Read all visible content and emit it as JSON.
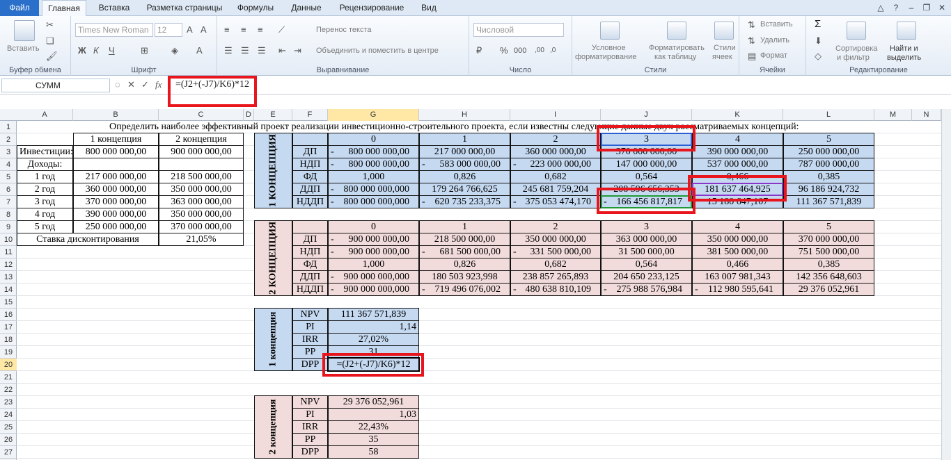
{
  "tabs": {
    "file": "Файл",
    "items": [
      "Главная",
      "Вставка",
      "Разметка страницы",
      "Формулы",
      "Данные",
      "Рецензирование",
      "Вид"
    ]
  },
  "ribbon": {
    "paste": "Вставить",
    "clipboard": "Буфер обмена",
    "font_name": "Times New Roman",
    "font_size": "12",
    "font_group": "Шрифт",
    "wrap": "Перенос текста",
    "merge": "Объединить и поместить в центре",
    "align_group": "Выравнивание",
    "number_format": "Числовой",
    "number_group": "Число",
    "cond_format": [
      "Условное",
      "форматирование"
    ],
    "format_table": [
      "Форматировать",
      "как таблицу"
    ],
    "styles": [
      "Стили",
      "ячеек"
    ],
    "styles_group": "Стили",
    "insert": "Вставить",
    "delete": "Удалить",
    "format": "Формат",
    "cells_group": "Ячейки",
    "sort": [
      "Сортировка",
      "и фильтр"
    ],
    "find": [
      "Найти и",
      "выделить"
    ],
    "edit_group": "Редактирование"
  },
  "formula_bar": {
    "name_box": "СУММ",
    "formula": "=(J2+(-J7)/K6)*12"
  },
  "columns": [
    "A",
    "B",
    "C",
    "D",
    "E",
    "F",
    "G",
    "H",
    "I",
    "J",
    "K",
    "L",
    "M",
    "N"
  ],
  "rows": [
    "1",
    "2",
    "3",
    "4",
    "5",
    "6",
    "7",
    "8",
    "9",
    "10",
    "11",
    "12",
    "13",
    "14",
    "15",
    "16",
    "17",
    "18",
    "19",
    "20",
    "21",
    "22",
    "23",
    "24",
    "25",
    "26",
    "27"
  ],
  "sheet": {
    "title": "Определить наиболее эффективный проект реализации инвестиционно-строительного проекта, если известны следующие данные двух рассматриваемых концепций:",
    "left": {
      "h1": "1 концепция",
      "h2": "2 концепция",
      "inv_label": "Инвестиции:",
      "inv1": "800 000 000,00",
      "inv2": "900 000 000,00",
      "inc_label": "Доходы:",
      "years": [
        [
          "1 год",
          "217 000 000,00",
          "218 500 000,00"
        ],
        [
          "2 год",
          "360 000 000,00",
          "350 000 000,00"
        ],
        [
          "3 год",
          "370 000 000,00",
          "363 000 000,00"
        ],
        [
          "4 год",
          "390 000 000,00",
          "350 000 000,00"
        ],
        [
          "5 год",
          "250 000 000,00",
          "370 000 000,00"
        ]
      ],
      "rate_label": "Ставка дисконтирования",
      "rate": "21,05%"
    },
    "periods": [
      "0",
      "1",
      "2",
      "3",
      "4",
      "5"
    ],
    "c1_label": "1 КОНЦЕПЦИЯ",
    "c2_label": "2 КОНЦЕПЦИЯ",
    "c1_rows": [
      [
        "ДП",
        "-",
        "800 000 000,00",
        "217 000 000,00",
        "360 000 000,00",
        "370 000 000,00",
        "390 000 000,00",
        "250 000 000,00"
      ],
      [
        "НДП",
        "-",
        "800 000 000,00",
        "-",
        "583 000 000,00",
        "-",
        "223 000 000,00",
        "147 000 000,00",
        "537 000 000,00",
        "787 000 000,00"
      ],
      [
        "ФД",
        "1,000",
        "0,826",
        "0,682",
        "0,564",
        "0,466",
        "0,385"
      ],
      [
        "ДДП",
        "-",
        "800 000 000,000",
        "179 264 766,625",
        "245 681 759,204",
        "208 596 656,353",
        "181 637 464,925",
        "96 186 924,732"
      ],
      [
        "НДДП",
        "-",
        "800 000 000,000",
        "-",
        "620 735 233,375",
        "-",
        "375 053 474,170",
        "-",
        "166 456 817,817",
        "15 180 647,107",
        "111 367 571,839"
      ]
    ],
    "c2_rows": [
      [
        "ДП",
        "-",
        "900 000 000,00",
        "218 500 000,00",
        "350 000 000,00",
        "363 000 000,00",
        "350 000 000,00",
        "370 000 000,00"
      ],
      [
        "НДП",
        "-",
        "900 000 000,00",
        "-",
        "681 500 000,00",
        "-",
        "331 500 000,00",
        "31 500 000,00",
        "381 500 000,00",
        "751 500 000,00"
      ],
      [
        "ФД",
        "1,000",
        "0,826",
        "0,682",
        "0,564",
        "0,466",
        "0,385"
      ],
      [
        "ДДП",
        "-",
        "900 000 000,000",
        "180 503 923,998",
        "238 857 265,893",
        "204 650 233,125",
        "163 007 981,343",
        "142 356 648,603"
      ],
      [
        "НДДП",
        "-",
        "900 000 000,000",
        "-",
        "719 496 076,002",
        "-",
        "480 638 810,109",
        "-",
        "275 988 576,984",
        "-",
        "112 980 595,641",
        "29 376 052,961"
      ]
    ],
    "k1_label": "1 концепция",
    "k2_label": "2 концепция",
    "k1": [
      [
        "NPV",
        "111 367 571,839"
      ],
      [
        "PI",
        "1,14"
      ],
      [
        "IRR",
        "27,02%"
      ],
      [
        "PP",
        "31"
      ],
      [
        "DPP",
        "=(J2+(-J7)/K6)*12"
      ]
    ],
    "k2": [
      [
        "NPV",
        "29 376 052,961"
      ],
      [
        "PI",
        "1,03"
      ],
      [
        "IRR",
        "22,43%"
      ],
      [
        "PP",
        "35"
      ],
      [
        "DPP",
        "58"
      ]
    ]
  }
}
